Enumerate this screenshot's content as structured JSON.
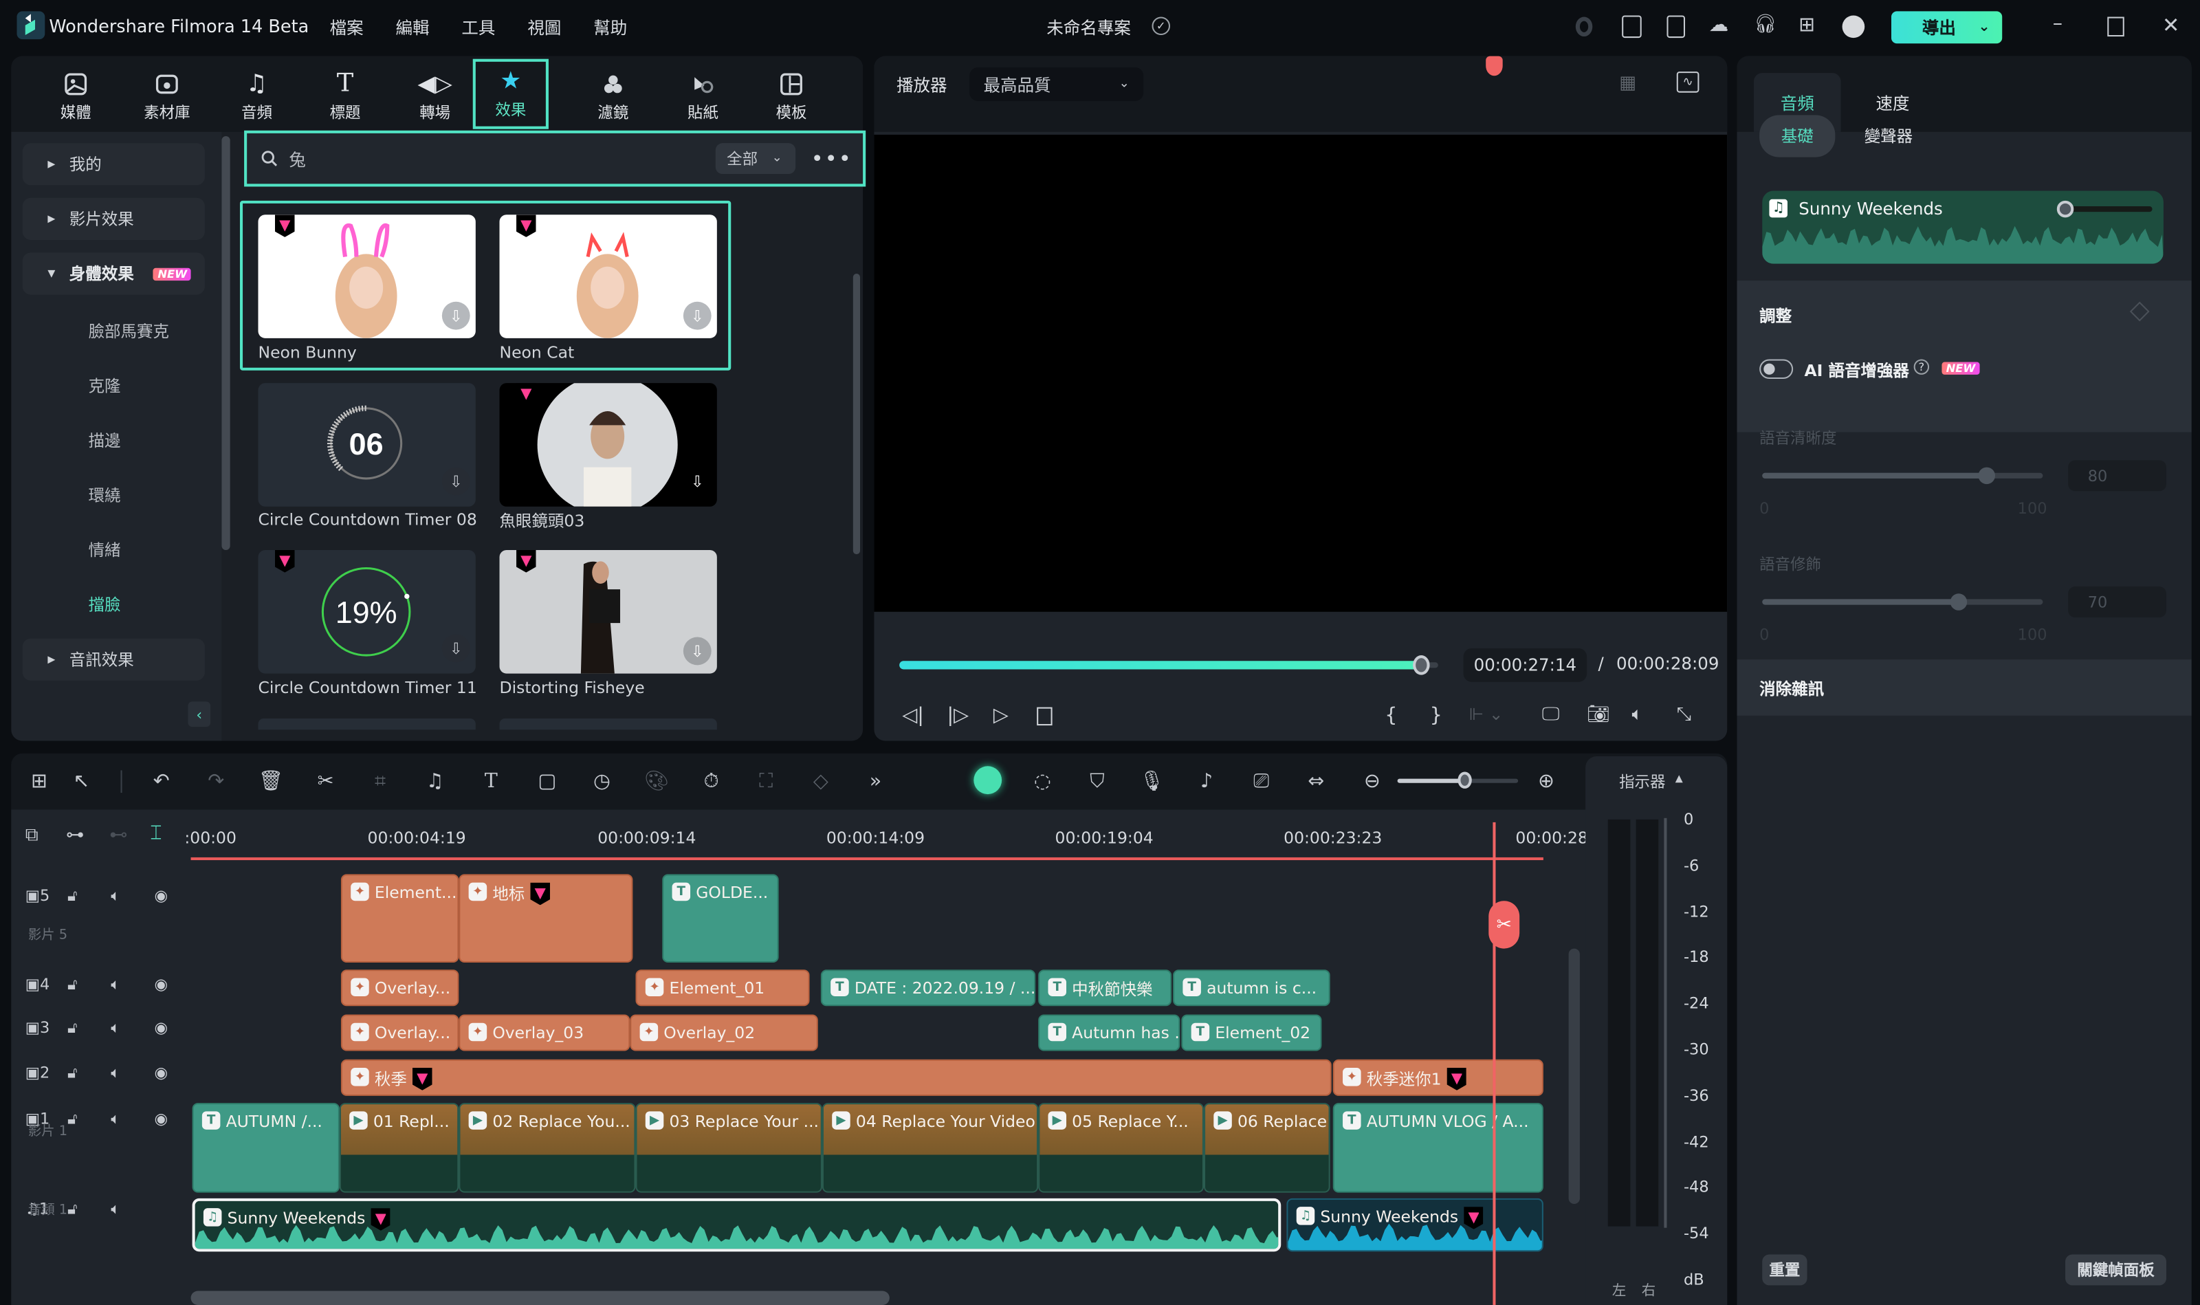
{
  "app": {
    "title": "Wondershare Filmora 14 Beta",
    "menu": [
      "檔案",
      "編輯",
      "工具",
      "視圖",
      "幫助"
    ],
    "project_name": "未命名專案",
    "export_label": "導出",
    "accent_color": "#51e3c4"
  },
  "library": {
    "tabs": [
      {
        "label": "媒體",
        "icon": "media-icon"
      },
      {
        "label": "素材庫",
        "icon": "stock-library-icon"
      },
      {
        "label": "音頻",
        "icon": "music-note-icon"
      },
      {
        "label": "標題",
        "icon": "title-t-icon"
      },
      {
        "label": "轉場",
        "icon": "transition-icon"
      },
      {
        "label": "效果",
        "icon": "effects-star-icon",
        "active": true
      },
      {
        "label": "濾鏡",
        "icon": "filter-icon"
      },
      {
        "label": "貼紙",
        "icon": "sticker-icon"
      },
      {
        "label": "模板",
        "icon": "template-icon"
      }
    ],
    "nav": {
      "groups": [
        {
          "label": "我的",
          "expanded": false
        },
        {
          "label": "影片效果",
          "expanded": false
        },
        {
          "label": "身體效果",
          "expanded": true,
          "badge": "NEW"
        },
        {
          "label": "音訊效果",
          "expanded": false
        }
      ],
      "sub_items": [
        "臉部馬賽克",
        "克隆",
        "描邊",
        "環繞",
        "情緒",
        "擋臉"
      ],
      "active_sub": "擋臉"
    },
    "search": {
      "value": "兔",
      "filter": "全部"
    },
    "items": [
      {
        "label": "Neon Bunny",
        "premium": true
      },
      {
        "label": "Neon Cat",
        "premium": true
      },
      {
        "label": "Circle Countdown Timer 08",
        "premium": false,
        "thumb_text": "06"
      },
      {
        "label": "魚眼鏡頭03",
        "premium": true
      },
      {
        "label": "Circle Countdown Timer 11",
        "premium": true,
        "thumb_text": "19%"
      },
      {
        "label": "Distorting Fisheye",
        "premium": true
      }
    ]
  },
  "player": {
    "label": "播放器",
    "quality": "最高品質",
    "current_time": "00:00:27:14",
    "separator": "/",
    "total_time": "00:00:28:09",
    "progress": 0.97
  },
  "properties": {
    "tabs": [
      "音頻",
      "速度"
    ],
    "active_tab": "音頻",
    "subtabs": [
      "基礎",
      "變聲器"
    ],
    "active_subtab": "基礎",
    "clip_name": "Sunny Weekends",
    "adjust_label": "調整",
    "ai_enhancer_label": "AI 語音增強器",
    "ai_enhancer_badge": "NEW",
    "ai_enhancer_on": false,
    "sliders": [
      {
        "label": "語音清晰度",
        "value": 80,
        "min": "0",
        "max": "100"
      },
      {
        "label": "語音修飾",
        "value": 70,
        "min": "0",
        "max": "100"
      }
    ],
    "denoise_label": "消除雜訊",
    "reset_label": "重置",
    "keyframe_panel_label": "關鍵幀面板"
  },
  "timeline": {
    "ruler_ticks": [
      ":00:00",
      "00:00:04:19",
      "00:00:09:14",
      "00:00:14:09",
      "00:00:19:04",
      "00:00:23:23",
      "00:00:28"
    ],
    "meter": {
      "label": "指示器",
      "scale": [
        "0",
        "-6",
        "-12",
        "-18",
        "-24",
        "-30",
        "-36",
        "-42",
        "-48",
        "-54",
        "dB"
      ],
      "channels": [
        "左",
        "右"
      ]
    },
    "tracks": [
      {
        "id": "5",
        "name": "影片 5",
        "clips": [
          {
            "label": "Element...",
            "type": "orange"
          },
          {
            "label": "地标",
            "type": "orange",
            "premium": true
          },
          {
            "label": "GOLDE...",
            "type": "teal"
          }
        ]
      },
      {
        "id": "4",
        "name": "",
        "clips": [
          {
            "label": "Overlay...",
            "type": "orange"
          },
          {
            "label": "Element_01",
            "type": "orange"
          },
          {
            "label": "DATE : 2022.09.19 / ...",
            "type": "teal"
          },
          {
            "label": "中秋節快樂",
            "type": "teal"
          },
          {
            "label": "autumn is c...",
            "type": "teal"
          }
        ]
      },
      {
        "id": "3",
        "name": "",
        "clips": [
          {
            "label": "Overlay...",
            "type": "orange"
          },
          {
            "label": "Overlay_03",
            "type": "orange"
          },
          {
            "label": "Overlay_02",
            "type": "orange"
          },
          {
            "label": "Autumn has ...",
            "type": "teal"
          },
          {
            "label": "Element_02",
            "type": "teal"
          }
        ]
      },
      {
        "id": "2",
        "name": "",
        "clips": [
          {
            "label": "秋季",
            "type": "orange",
            "premium": true
          },
          {
            "label": "秋季迷你1",
            "type": "orange",
            "premium": true
          }
        ]
      },
      {
        "id": "1",
        "name": "影片 1",
        "clips": [
          {
            "label": "AUTUMN /...",
            "type": "teal"
          },
          {
            "label": "01 Repl...",
            "type": "video"
          },
          {
            "label": "02 Replace You...",
            "type": "video"
          },
          {
            "label": "03 Replace Your ...",
            "type": "video"
          },
          {
            "label": "04 Replace Your Video",
            "type": "video"
          },
          {
            "label": "05 Replace Y...",
            "type": "video"
          },
          {
            "label": "06 Replace ...",
            "type": "video"
          },
          {
            "label": "AUTUMN VLOG / A...",
            "type": "teal"
          }
        ]
      },
      {
        "id": "1",
        "name": "音頻 1",
        "audio": true,
        "clips": [
          {
            "label": "Sunny Weekends",
            "type": "audio",
            "premium": true
          },
          {
            "label": "Sunny Weekends",
            "type": "audio-blue",
            "premium": true
          }
        ]
      }
    ]
  }
}
